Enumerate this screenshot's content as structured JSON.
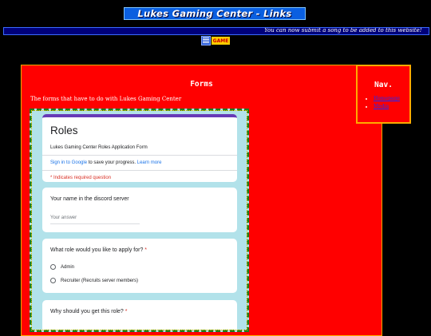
{
  "site": {
    "banner_title": "Lukes Gaming Center - Links",
    "marquee_text": "You can now submit a song to be added to this website!",
    "badge_text": "GAME"
  },
  "main": {
    "heading": "Forms",
    "description": "The forms that have to do with Lukes Gaming Center"
  },
  "nav": {
    "heading": "Nav.",
    "links": [
      "Homepage",
      "Media"
    ]
  },
  "form": {
    "title": "Roles",
    "subtitle": "Lukes Gaming Center Roles Application Form",
    "signin_link": "Sign in to Google",
    "signin_rest": " to save your progress. ",
    "learn_more": "Learn more",
    "required_note": "* Indicates required question",
    "q1": {
      "label": "Your name in the discord server",
      "placeholder": "Your answer"
    },
    "q2": {
      "label": "What role would you like to apply for?",
      "required": " *",
      "options": [
        "Admin",
        "Recruiter (Recruits server members)"
      ]
    },
    "q3": {
      "label": "Why should you get this role?",
      "required": " *"
    }
  },
  "colors": {
    "accent": "#673ab7",
    "page_red": "#ff0000",
    "border_orange": "#ffaa00",
    "link": "#1a73e8"
  }
}
